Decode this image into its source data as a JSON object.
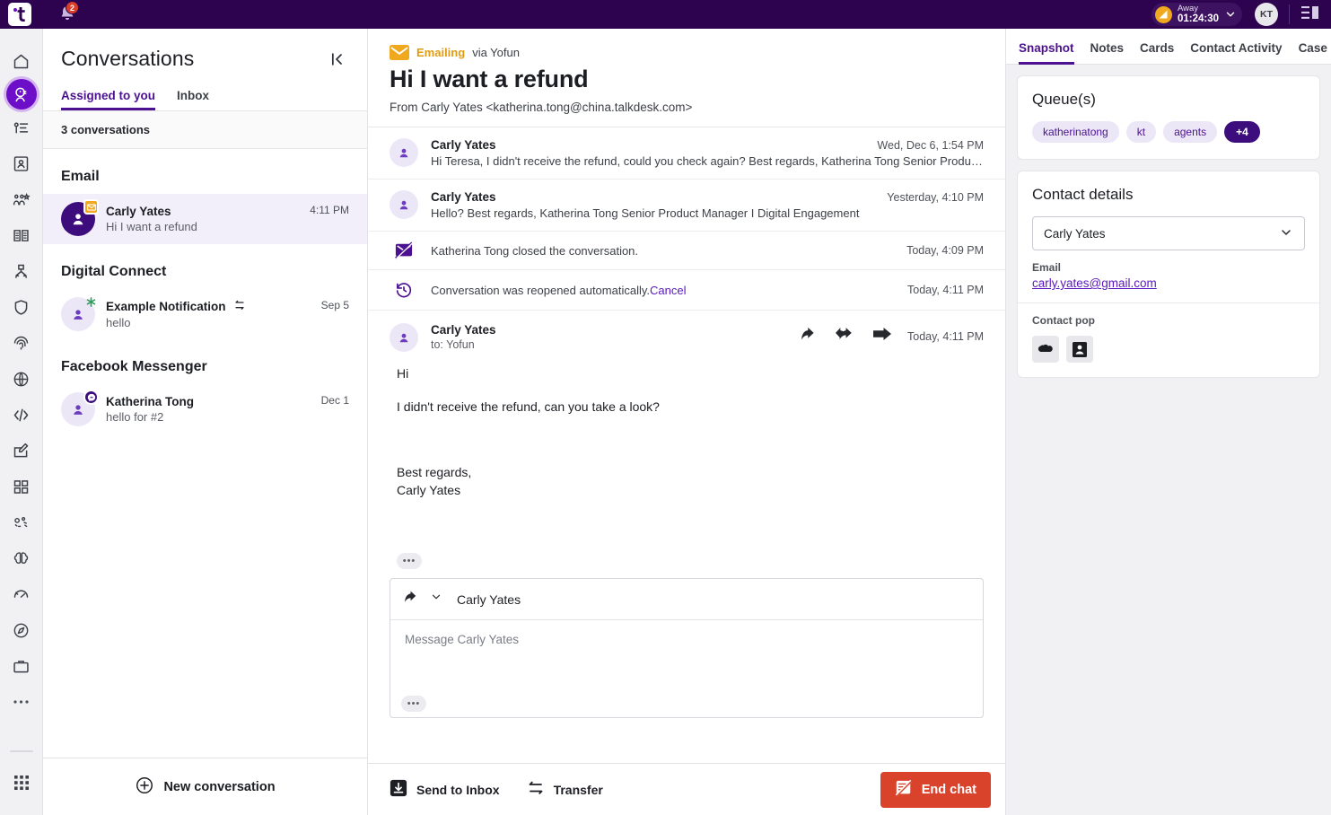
{
  "topbar": {
    "logo_alt": "talkdesk-logo",
    "notification_count": "2",
    "status_label": "Away",
    "status_timer": "01:24:30",
    "user_initials": "KT"
  },
  "rail": {
    "items": [
      {
        "name": "home-icon",
        "label": "Home"
      },
      {
        "name": "conversations-icon",
        "label": "Conversations"
      },
      {
        "name": "activities-icon",
        "label": "Activities"
      },
      {
        "name": "contacts-icon",
        "label": "Contacts"
      },
      {
        "name": "customer-journey-icon",
        "label": "Customer Journey"
      },
      {
        "name": "knowledge-base-icon",
        "label": "Knowledge Base"
      },
      {
        "name": "routing-icon",
        "label": "Routing"
      },
      {
        "name": "quality-icon",
        "label": "Quality Management"
      },
      {
        "name": "identity-icon",
        "label": "Identity"
      },
      {
        "name": "globe-icon",
        "label": "Global"
      },
      {
        "name": "developer-icon",
        "label": "Developers"
      },
      {
        "name": "studio-icon",
        "label": "Studio"
      },
      {
        "name": "apps-icon",
        "label": "Apps"
      },
      {
        "name": "automation-icon",
        "label": "Automation"
      },
      {
        "name": "ai-brain-icon",
        "label": "AI"
      },
      {
        "name": "performance-icon",
        "label": "Performance"
      },
      {
        "name": "explore-icon",
        "label": "Explore"
      },
      {
        "name": "workspace-icon",
        "label": "Workspace"
      },
      {
        "name": "more-icon",
        "label": "More"
      }
    ],
    "bottom_item": {
      "name": "app-grid-icon",
      "label": "All apps"
    }
  },
  "conversations": {
    "title": "Conversations",
    "collapse_icon": "collapse-panel-icon",
    "tabs": [
      {
        "label": "Assigned to you",
        "active": true
      },
      {
        "label": "Inbox",
        "active": false
      }
    ],
    "count_label": "3 conversations",
    "groups": [
      {
        "title": "Email",
        "items": [
          {
            "name": "Carly Yates",
            "preview": "Hi I want a refund",
            "time": "4:11 PM",
            "selected": true,
            "badge": "email-badge-icon",
            "avatar_style": "solid"
          }
        ]
      },
      {
        "title": "Digital Connect",
        "items": [
          {
            "name": "Example Notification",
            "preview": "hello",
            "time": "Sep 5",
            "selected": false,
            "badge": "star-badge-icon",
            "avatar_style": "light",
            "extra_icon": "transfer-icon"
          }
        ]
      },
      {
        "title": "Facebook Messenger",
        "items": [
          {
            "name": "Katherina Tong",
            "preview": "hello for #2",
            "time": "Dec 1",
            "selected": false,
            "badge": "messenger-badge-icon",
            "avatar_style": "light"
          }
        ]
      }
    ],
    "new_conversation_label": "New conversation"
  },
  "conversation": {
    "channel_label": "Emailing",
    "channel_via": "via Yofun",
    "title": "Hi I want a refund",
    "from_line": "From Carly Yates <katherina.tong@china.talkdesk.com>",
    "thread": [
      {
        "type": "message",
        "name": "Carly Yates",
        "preview": "Hi Teresa, I didn't receive the refund, could you check again? Best regards, Katherina Tong Senior Product Manage…",
        "time": "Wed, Dec 6, 1:54 PM"
      },
      {
        "type": "message",
        "name": "Carly Yates",
        "preview": "Hello? Best regards, Katherina Tong Senior Product Manager I Digital Engagement",
        "time": "Yesterday, 4:10 PM"
      },
      {
        "type": "system",
        "icon": "conversation-closed-icon",
        "text": "Katherina Tong closed the conversation.",
        "time": "Today, 4:09 PM"
      },
      {
        "type": "system",
        "icon": "conversation-reopened-icon",
        "text": "Conversation was reopened automatically.",
        "link": "Cancel",
        "time": "Today, 4:11 PM"
      }
    ],
    "open_message": {
      "name": "Carly Yates",
      "to": "to: Yofun",
      "time": "Today, 4:11 PM",
      "actions": [
        "reply-icon",
        "reply-all-icon",
        "forward-icon"
      ],
      "lines": [
        "Hi",
        "I didn't receive the refund, can you take a look?",
        "",
        "Best regards,",
        "Carly Yates"
      ],
      "body_p1": "Hi",
      "body_p2": "I didn't receive the refund, can you take a look?",
      "body_p3": "Best regards,",
      "body_p4": "Carly Yates",
      "overflow_label": "•••"
    },
    "composer": {
      "mode_icon": "reply-icon",
      "chevron_icon": "chevron-down-icon",
      "recipient": "Carly Yates",
      "placeholder": "Message Carly Yates",
      "overflow_label": "•••"
    },
    "actions": {
      "send_to_inbox": "Send to Inbox",
      "transfer": "Transfer",
      "end_chat": "End chat"
    }
  },
  "rightpanel": {
    "tabs": [
      {
        "label": "Snapshot",
        "active": true
      },
      {
        "label": "Notes",
        "active": false
      },
      {
        "label": "Cards",
        "active": false
      },
      {
        "label": "Contact Activity",
        "active": false
      },
      {
        "label": "Case",
        "active": false
      }
    ],
    "queues": {
      "title": "Queue(s)",
      "chips": [
        "katherinatong",
        "kt",
        "agents"
      ],
      "more": "+4"
    },
    "contact_details": {
      "title": "Contact details",
      "selected_contact": "Carly Yates",
      "email_label": "Email",
      "email_value": "carly.yates@gmail.com",
      "contact_pop_label": "Contact pop",
      "pop_icons": [
        "salesforce-cloud-icon",
        "contact-card-icon"
      ]
    }
  },
  "colors": {
    "brand_purple": "#4c1191",
    "topbar": "#2d0350",
    "accent_amber": "#f0a81e",
    "danger_red": "#d9432b",
    "badge_red": "#d93e2a"
  }
}
